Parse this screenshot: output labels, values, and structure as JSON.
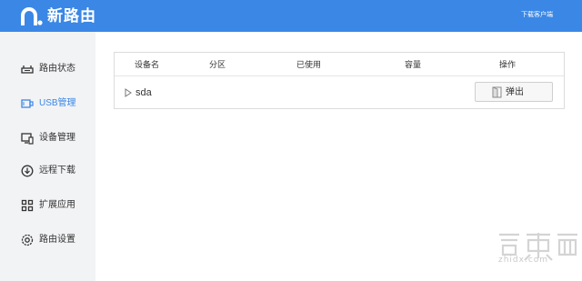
{
  "header": {
    "brand": "新路由",
    "download_link": "下载客户端"
  },
  "sidebar": {
    "items": [
      {
        "label": "路由状态",
        "icon": "router-status-icon",
        "active": false
      },
      {
        "label": "USB管理",
        "icon": "usb-icon",
        "active": true
      },
      {
        "label": "设备管理",
        "icon": "device-icon",
        "active": false
      },
      {
        "label": "远程下载",
        "icon": "download-icon",
        "active": false
      },
      {
        "label": "扩展应用",
        "icon": "apps-icon",
        "active": false
      },
      {
        "label": "路由设置",
        "icon": "settings-icon",
        "active": false
      }
    ]
  },
  "table": {
    "headers": [
      "设备名",
      "分区",
      "已使用",
      "容量",
      "操作"
    ],
    "rows": [
      {
        "name": "sda",
        "partition": "",
        "used": "",
        "capacity": "",
        "action": "弹出"
      }
    ]
  },
  "watermark": {
    "logo_text": "智東西",
    "url": "zhidx.com"
  },
  "colors": {
    "accent": "#3a87e6",
    "sidebar_bg": "#f2f3f5",
    "border": "#dcdcdc"
  }
}
